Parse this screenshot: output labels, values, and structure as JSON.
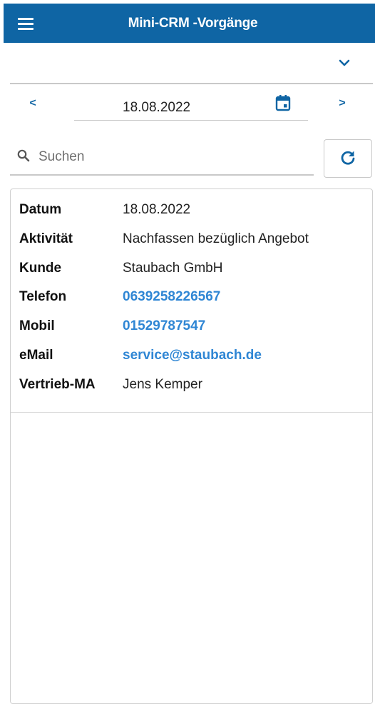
{
  "header": {
    "title": "Mini-CRM -Vorgänge",
    "menu_icon": "hamburger-menu-icon",
    "background_color": "#0f65a4"
  },
  "top_select": {
    "value": "",
    "icon": "chevron-down-icon"
  },
  "date_nav": {
    "prev_label": "<",
    "next_label": ">",
    "date": "18.08.2022",
    "calendar_icon": "calendar-icon"
  },
  "search": {
    "placeholder": "Suchen",
    "value": "",
    "search_icon": "search-icon",
    "refresh_icon": "refresh-icon"
  },
  "details": {
    "datum": {
      "label": "Datum",
      "value": "18.08.2022"
    },
    "aktivitaet": {
      "label": "Aktivität",
      "value": "Nachfassen bezüglich Angebot"
    },
    "kunde": {
      "label": "Kunde",
      "value": "Staubach GmbH"
    },
    "telefon": {
      "label": "Telefon",
      "value": "0639258226567"
    },
    "mobil": {
      "label": "Mobil",
      "value": "01529787547"
    },
    "email": {
      "label": "eMail",
      "value": "service@staubach.de"
    },
    "vertrieb": {
      "label": "Vertrieb-MA",
      "value": "Jens Kemper"
    }
  },
  "colors": {
    "accent": "#0f65a4",
    "link": "#2f86d4"
  }
}
